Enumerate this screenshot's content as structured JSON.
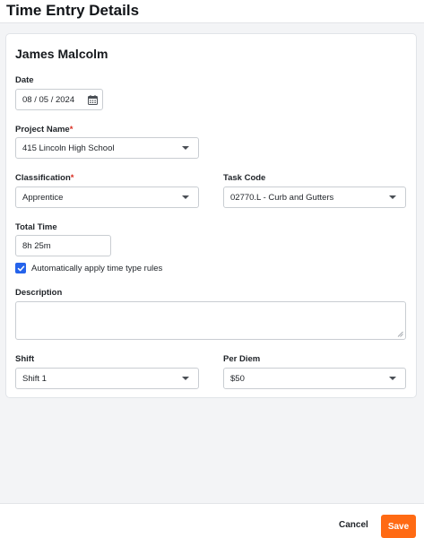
{
  "header": {
    "title": "Time Entry Details"
  },
  "entry": {
    "employee_name": "James Malcolm",
    "date": {
      "label": "Date",
      "value": "08 / 05 / 2024"
    },
    "project": {
      "label": "Project Name",
      "required_mark": "*",
      "value": "415 Lincoln High School"
    },
    "classification": {
      "label": "Classification",
      "required_mark": "*",
      "value": "Apprentice"
    },
    "task_code": {
      "label": "Task Code",
      "value": "02770.L - Curb and Gutters"
    },
    "total_time": {
      "label": "Total Time",
      "value": "8h 25m"
    },
    "auto_rules": {
      "label": "Automatically apply time type rules",
      "checked": true
    },
    "description": {
      "label": "Description",
      "value": ""
    },
    "shift": {
      "label": "Shift",
      "value": "Shift 1"
    },
    "per_diem": {
      "label": "Per Diem",
      "value": "$50"
    }
  },
  "footer": {
    "cancel_label": "Cancel",
    "save_label": "Save"
  },
  "colors": {
    "accent": "#ff6a13",
    "checkbox": "#2563eb",
    "required": "#d92d20"
  },
  "icons": {
    "date": "calendar-icon",
    "dropdown": "chevron-down-icon",
    "check": "check-icon"
  }
}
